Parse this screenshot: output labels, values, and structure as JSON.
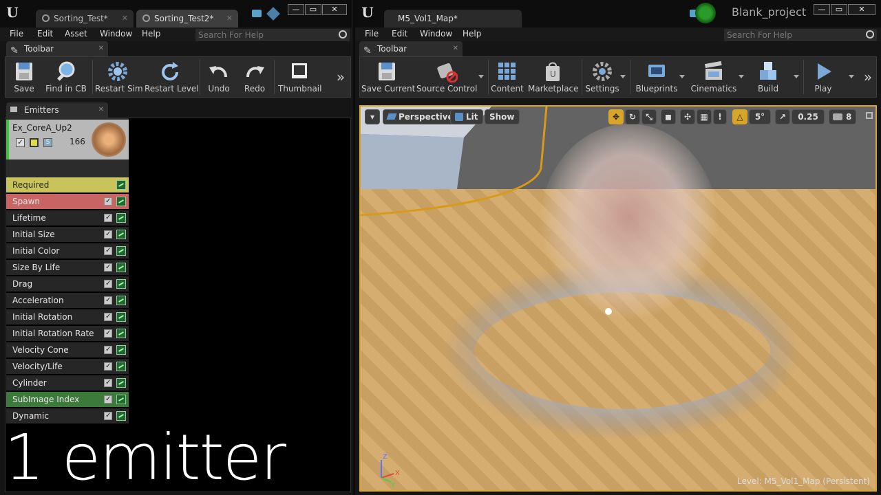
{
  "left": {
    "tabs": [
      "Sorting_Test*",
      "Sorting_Test2*"
    ],
    "menu": [
      "File",
      "Edit",
      "Asset",
      "Window",
      "Help"
    ],
    "search_placeholder": "Search For Help",
    "toolbar_tab": "Toolbar",
    "toolbar_buttons": [
      "Save",
      "Find in CB",
      "Restart Sim",
      "Restart Level",
      "Undo",
      "Redo",
      "Thumbnail"
    ],
    "emitters_tab": "Emitters",
    "emitter": {
      "name": "Ex_CoreA_Up2",
      "count": "166"
    },
    "modules": [
      "Required",
      "Spawn",
      "Lifetime",
      "Initial Size",
      "Initial Color",
      "Size By Life",
      "Drag",
      "Acceleration",
      "Initial Rotation",
      "Initial Rotation Rate",
      "Velocity Cone",
      "Velocity/Life",
      "Cylinder",
      "SubImage Index",
      "Dynamic"
    ],
    "module_colors": {
      "Required": "#c8c35a",
      "Spawn": "#c86464",
      "SubImage Index": "#3c7a3c"
    },
    "caption": "1 emitter"
  },
  "right": {
    "tab": "M5_Vol1_Map*",
    "project": "Blank_project",
    "menu": [
      "File",
      "Edit",
      "Window",
      "Help"
    ],
    "search_placeholder": "Search For Help",
    "toolbar_tab": "Toolbar",
    "toolbar_buttons": [
      "Save Current",
      "Source Control",
      "Content",
      "Marketplace",
      "Settings",
      "Blueprints",
      "Cinematics",
      "Build",
      "Play"
    ],
    "viewport": {
      "perspective": "Perspective",
      "lit": "Lit",
      "show": "Show",
      "angle_snap": "5°",
      "scale_snap": "0.25",
      "camera_speed": "8",
      "level_label": "Level:",
      "level_name": "M5_Vol1_Map (Persistent)"
    }
  }
}
